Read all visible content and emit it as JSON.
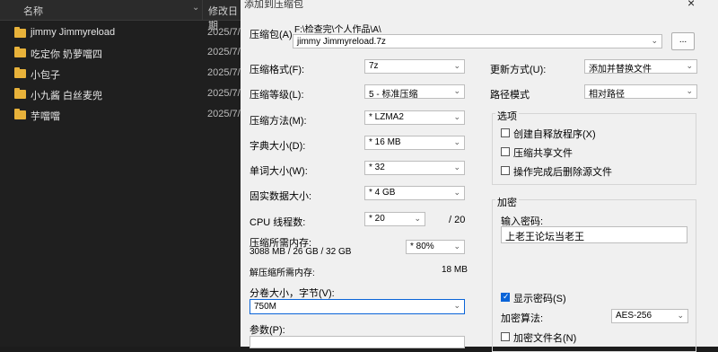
{
  "explorer": {
    "col_name": "名称",
    "col_date": "修改日期",
    "rows": [
      {
        "name": "jimmy Jimmyreload",
        "date": "2025/7/"
      },
      {
        "name": "吃定你 奶萝噹四",
        "date": "2025/7/"
      },
      {
        "name": "小包子",
        "date": "2025/7/"
      },
      {
        "name": "小九酱 白丝麦兜",
        "date": "2025/7/"
      },
      {
        "name": "芋噹噹",
        "date": "2025/7/"
      }
    ]
  },
  "dialog": {
    "title": "添加到压缩包",
    "close": "×",
    "archive_label": "压缩包(A)",
    "archive_path": "F:\\检查完\\个人作品\\A\\",
    "archive_name": "jimmy Jimmyreload.7z",
    "browse": "...",
    "fields": [
      {
        "label": "压缩格式(F):",
        "value": "7z"
      },
      {
        "label": "压缩等级(L):",
        "value": "5 - 标准压缩"
      },
      {
        "label": "压缩方法(M):",
        "value": "* LZMA2"
      },
      {
        "label": "字典大小(D):",
        "value": "* 16 MB"
      },
      {
        "label": "单词大小(W):",
        "value": "* 32"
      },
      {
        "label": "固实数据大小:",
        "value": "* 4 GB"
      }
    ],
    "cpu_label": "CPU 线程数:",
    "cpu_value": "* 20",
    "cpu_total": "/ 20",
    "mem_label": "压缩所需内存:",
    "mem_detail": "3088 MB / 26 GB / 32 GB",
    "mem_percent": "* 80%",
    "decomp_label": "解压缩所需内存:",
    "decomp_value": "18 MB",
    "split_label": "分卷大小，字节(V):",
    "split_value": "750M",
    "params_label": "参数(P):",
    "update_label": "更新方式(U):",
    "update_value": "添加并替换文件",
    "path_label": "路径模式",
    "path_value": "相对路径",
    "options_title": "选项",
    "options": [
      {
        "label": "创建自释放程序(X)",
        "checked": false
      },
      {
        "label": "压缩共享文件",
        "checked": false
      },
      {
        "label": "操作完成后删除源文件",
        "checked": false
      }
    ],
    "encrypt_title": "加密",
    "password_label": "输入密码:",
    "password_value": "上老王论坛当老王",
    "show_password": "显示密码(S)",
    "enc_method_label": "加密算法:",
    "enc_method_value": "AES-256",
    "enc_names": "加密文件名(N)"
  }
}
